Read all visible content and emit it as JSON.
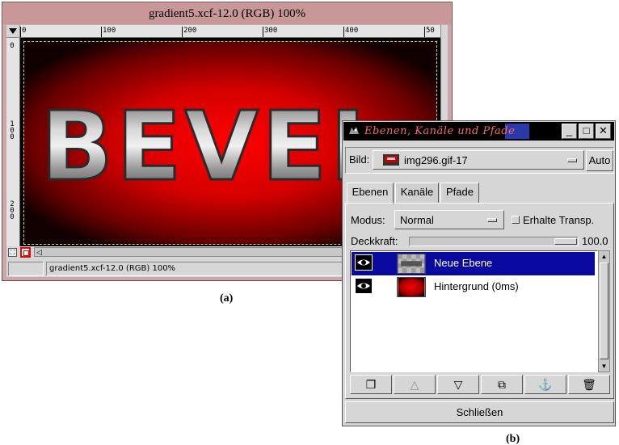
{
  "image_window": {
    "title": "gradient5.xcf-12.0 (RGB) 100%",
    "status": "gradient5.xcf-12.0 (RGB) 100%",
    "hruler_labels": [
      "0",
      "100",
      "200",
      "300",
      "400",
      "50"
    ],
    "vruler_labels": [
      "0",
      "1 0 0",
      "2 0 0"
    ],
    "canvas_text": "BEVEL",
    "caption": "(a)"
  },
  "layers_dialog": {
    "title": "Ebenen, Kanäle und Pfade",
    "minimize_label": "_",
    "maximize_label": "□",
    "close_label": "✕",
    "image_label": "Bild:",
    "image_value": "img296.gif-17",
    "auto_label": "Auto",
    "tabs": [
      {
        "label": "Ebenen",
        "active": true
      },
      {
        "label": "Kanäle",
        "active": false
      },
      {
        "label": "Pfade",
        "active": false
      }
    ],
    "mode_label": "Modus:",
    "mode_value": "Normal",
    "keep_trans_label": "Erhalte Transp.",
    "keep_trans_checked": false,
    "opacity_label": "Deckkraft:",
    "opacity_value": "100.0",
    "layers": [
      {
        "name": "Neue Ebene",
        "visible": true,
        "selected": true,
        "thumb": "bevel-thumbnail"
      },
      {
        "name": "Hintergrund (0ms)",
        "visible": true,
        "selected": false,
        "thumb": "red-gradient-thumbnail"
      }
    ],
    "toolbar": [
      {
        "icon": "new-layer-icon",
        "glyph": "❐",
        "enabled": true
      },
      {
        "icon": "raise-layer-icon",
        "glyph": "△",
        "enabled": false
      },
      {
        "icon": "lower-layer-icon",
        "glyph": "▽",
        "enabled": true
      },
      {
        "icon": "duplicate-layer-icon",
        "glyph": "⧉",
        "enabled": true
      },
      {
        "icon": "anchor-icon",
        "glyph": "⚓",
        "enabled": false
      },
      {
        "icon": "trash-icon",
        "glyph": "🗑",
        "enabled": true
      }
    ],
    "close_button": "Schließen",
    "caption": "(b)"
  }
}
